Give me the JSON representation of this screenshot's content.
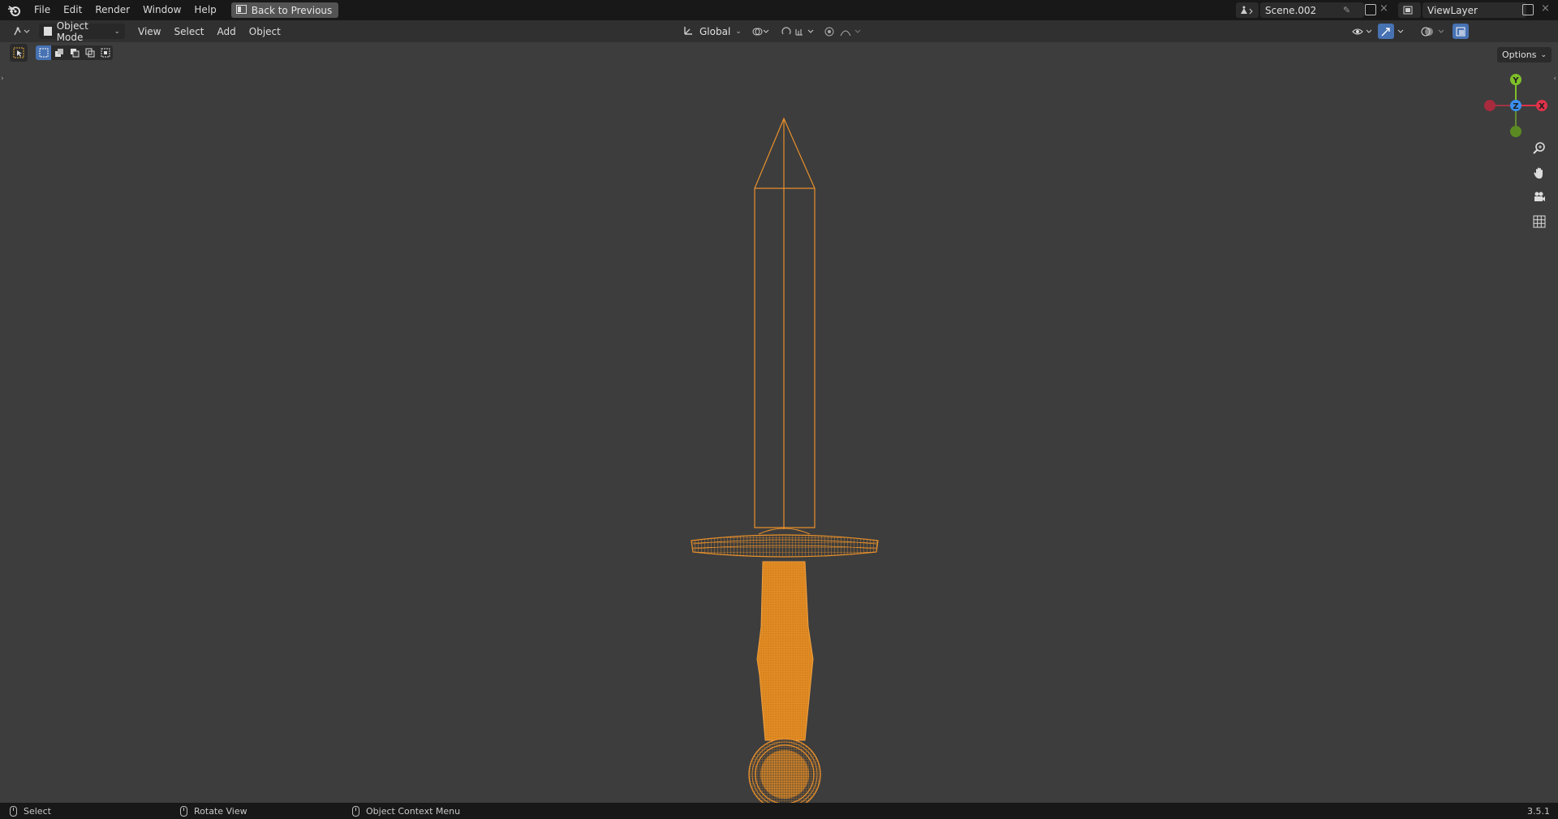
{
  "topbar": {
    "menus": [
      "File",
      "Edit",
      "Render",
      "Window",
      "Help"
    ],
    "back_label": "Back to Previous",
    "scene_name": "Scene.002",
    "view_layer": "ViewLayer"
  },
  "header": {
    "mode_label": "Object Mode",
    "menus": [
      "View",
      "Select",
      "Add",
      "Object"
    ],
    "orientation_label": "Global",
    "options_label": "Options"
  },
  "gizmo": {
    "y": "Y",
    "z": "Z",
    "x": "X"
  },
  "status": {
    "left_label": "Select",
    "middle_label": "Rotate View",
    "right_label": "Object Context Menu",
    "version": "3.5.1"
  },
  "colors": {
    "wire": "#e8902b",
    "viewport": "#3d3d3d",
    "x_axis": "#e0324a",
    "y_axis": "#7fbf2a",
    "z_axis": "#3a8ff0"
  },
  "icons": [
    "blender-logo-icon",
    "back-icon",
    "scene-icon",
    "pin-icon",
    "new-scene-icon",
    "close-icon",
    "view-layer-icon",
    "editor-type-icon",
    "object-mode-icon",
    "transform-orientation-icon",
    "pivot-icon",
    "snap-icon",
    "proportional-icon",
    "visibility-icon",
    "gizmo-icon",
    "overlay-icon",
    "xray-icon",
    "wireframe-shading-icon",
    "solid-shading-icon",
    "material-shading-icon",
    "rendered-shading-icon",
    "zoom-icon",
    "hand-icon",
    "camera-icon",
    "grid-icon"
  ]
}
